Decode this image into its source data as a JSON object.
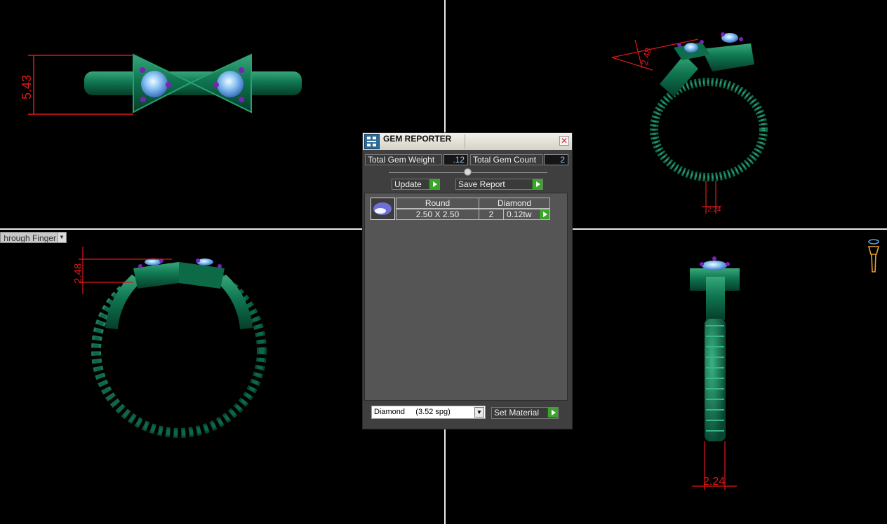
{
  "panel": {
    "title": "GEM REPORTER",
    "total_weight_label": "Total Gem Weight",
    "total_weight_value": ".12",
    "total_count_label": "Total Gem Count",
    "total_count_value": "2",
    "update_label": "Update",
    "save_label": "Save Report",
    "gem": {
      "shape": "Round",
      "material": "Diamond",
      "size": "2.50 X 2.50",
      "count": "2",
      "weight": "0.12tw"
    },
    "material_select": "Diamond     (3.52 spg)",
    "set_material_label": "Set Material"
  },
  "viewport": {
    "mode_label": "hrough Finger",
    "dims": {
      "top_left": "5.43",
      "bottom_left": "2.48",
      "top_right": "2.48",
      "top_right_small": "2.24",
      "bottom_right": "2.24"
    }
  },
  "colors": {
    "metal": "#0e6e4c",
    "gem": "#8fc8f4",
    "accent_gem": "#7a22b8",
    "dimension": "#e01818",
    "button_green": "#3aa52a"
  }
}
